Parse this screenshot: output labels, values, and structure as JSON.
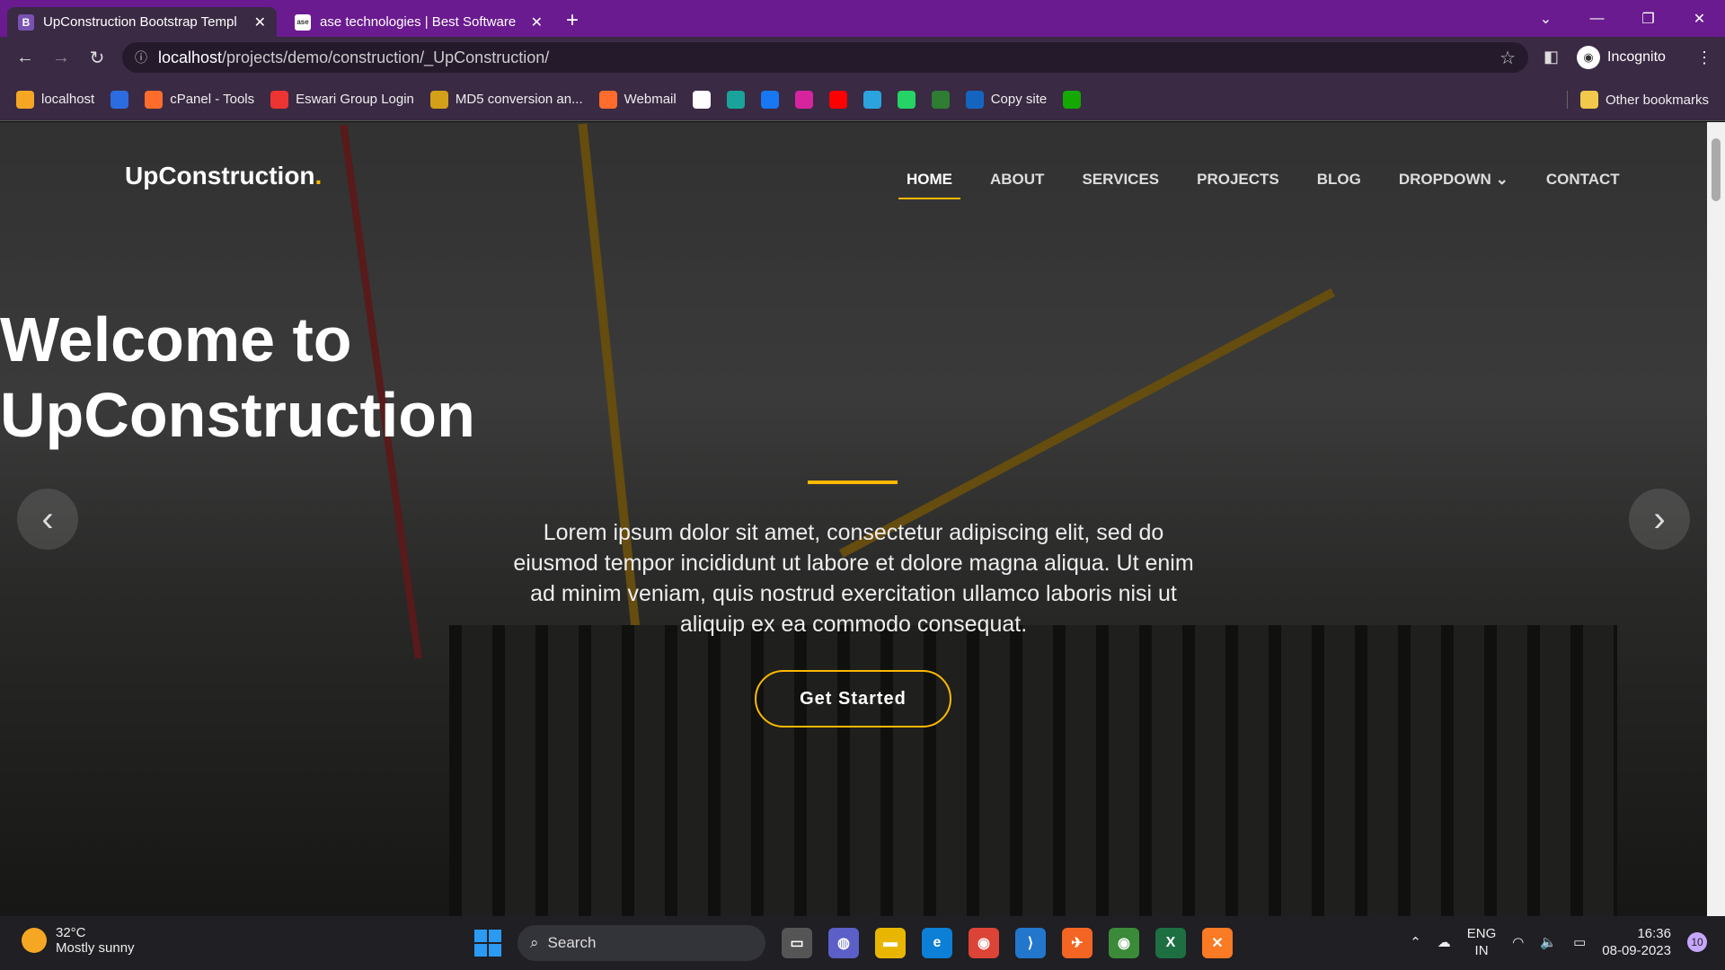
{
  "browser": {
    "tabs": [
      {
        "title": "UpConstruction Bootstrap Templ",
        "favicon": "B"
      },
      {
        "title": "ase technologies | Best Software",
        "favicon": "ase"
      }
    ],
    "new_tab": "+",
    "url_host": "localhost",
    "url_path": "/projects/demo/construction/_UpConstruction/",
    "profile": "Incognito",
    "bookmarks": [
      {
        "label": "localhost",
        "color": "#f5a623"
      },
      {
        "label": "",
        "color": "#2b6de0"
      },
      {
        "label": "cPanel - Tools",
        "color": "#ff6c2c"
      },
      {
        "label": "Eswari Group Login",
        "color": "#e33"
      },
      {
        "label": "MD5 conversion an...",
        "color": "#d4a017"
      },
      {
        "label": "Webmail",
        "color": "#ff6c2c"
      },
      {
        "label": "",
        "color": "#fff"
      },
      {
        "label": "",
        "color": "#1aa39a"
      },
      {
        "label": "",
        "color": "#1877f2"
      },
      {
        "label": "",
        "color": "#d6249f"
      },
      {
        "label": "",
        "color": "#ff0000"
      },
      {
        "label": "",
        "color": "#2aa3de"
      },
      {
        "label": "",
        "color": "#25d366"
      },
      {
        "label": "",
        "color": "#2e7d32"
      },
      {
        "label": "Copy site",
        "color": "#1565c0"
      },
      {
        "label": "",
        "color": "#14a800"
      }
    ],
    "other_bookmarks": "Other bookmarks"
  },
  "site": {
    "logo": "UpConstruction",
    "logo_dot": ".",
    "menu": [
      "HOME",
      "ABOUT",
      "SERVICES",
      "PROJECTS",
      "BLOG",
      "DROPDOWN",
      "CONTACT"
    ],
    "hero_title_line1": "Welcome to",
    "hero_title_line2": "UpConstruction",
    "hero_text": "Lorem ipsum dolor sit amet, consectetur adipiscing elit, sed do eiusmod tempor incididunt ut labore et dolore magna aliqua. Ut enim ad minim veniam, quis nostrud exercitation ullamco laboris nisi ut aliquip ex ea commodo consequat.",
    "cta": "Get Started",
    "accent": "#feb900"
  },
  "taskbar": {
    "temp": "32°C",
    "weather": "Mostly sunny",
    "search": "Search",
    "lang1": "ENG",
    "lang2": "IN",
    "time": "16:36",
    "date": "08-09-2023",
    "notifications": "10"
  }
}
